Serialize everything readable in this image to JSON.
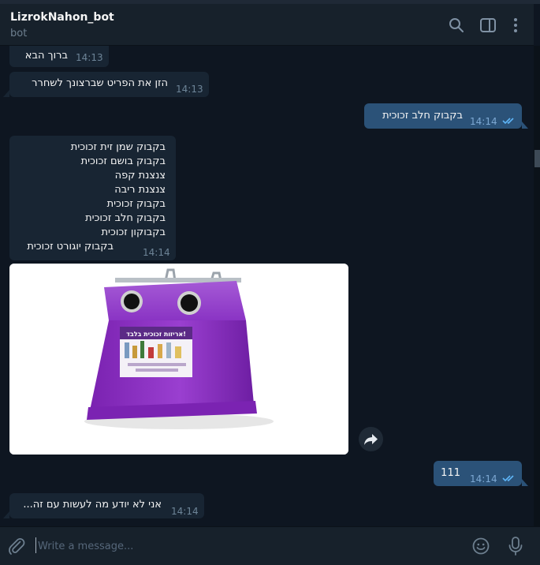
{
  "header": {
    "title": "LizrokNahon_bot",
    "subtitle": "bot"
  },
  "messages": [
    {
      "text": "ברוך הבא",
      "time": "14:13"
    },
    {
      "text": "הזן את הפריט שברצונך לשחרר",
      "time": "14:13"
    },
    {
      "text": "בקבוק חלב זכוכית",
      "time": "14:14",
      "status": "read"
    },
    {
      "lines": [
        "בקבוק שמן זית זכוכית",
        "בקבוק בושם זכוכית",
        "צנצנת קפה",
        "צנצנת ריבה",
        "בקבוק זכוכית",
        "בקבוק חלב זכוכית",
        "בקבוקון זכוכית",
        "בקבוק יוגורט זכוכית"
      ],
      "time": "14:14"
    },
    {
      "type": "photo",
      "sign_title": "אריזות זכוכית בלבד!"
    },
    {
      "text": "111",
      "time": "14:14",
      "status": "read"
    },
    {
      "text": "אני לא יודע מה לעשות עם זה...",
      "time": "14:14"
    }
  ],
  "composer": {
    "placeholder": "Write a message..."
  },
  "icons": {
    "search": "search-icon",
    "sidebar": "sidebar-toggle-icon",
    "menu": "more-vertical-icon",
    "attach": "paperclip-icon",
    "emoji": "smile-icon",
    "mic": "microphone-icon",
    "share": "share-arrow-icon"
  },
  "colors": {
    "background": "#0e1621",
    "incoming": "#182533",
    "outgoing": "#2b5278",
    "accent": "#5eb5f7",
    "bin": "#8e2fc2"
  }
}
